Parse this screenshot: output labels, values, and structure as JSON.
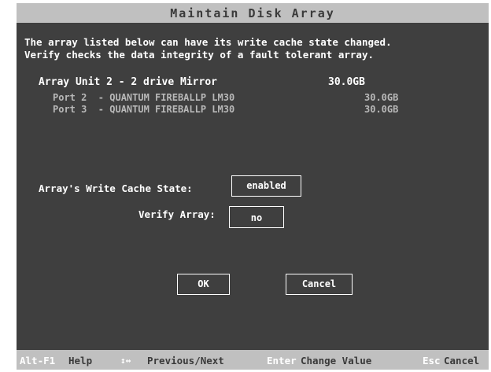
{
  "window": {
    "title": "Maintain Disk Array"
  },
  "intro": {
    "line1": "The array listed below can have its write cache state changed.",
    "line2": "Verify checks the data integrity of a fault tolerant array."
  },
  "array": {
    "unit_label": "Array Unit 2 - 2 drive Mirror",
    "unit_size": "30.0GB",
    "ports": [
      {
        "label": "Port 2  - QUANTUM FIREBALLP LM30",
        "size": "30.0GB"
      },
      {
        "label": "Port 3  - QUANTUM FIREBALLP LM30",
        "size": "30.0GB"
      }
    ]
  },
  "form": {
    "write_cache_label": "Array's Write Cache State:",
    "write_cache_value": "enabled",
    "verify_label": "Verify Array:",
    "verify_value": "no"
  },
  "buttons": {
    "ok": "OK",
    "cancel": "Cancel"
  },
  "statusbar": {
    "help_key": "Alt-F1",
    "help_label": "Help",
    "nav_icon": "↕↔",
    "nav_label": "Previous/Next",
    "enter_key": "Enter",
    "enter_label": "Change Value",
    "esc_key": "Esc",
    "esc_label": "Cancel"
  },
  "colors": {
    "screen_bg": "#3f3f3f",
    "bar_bg": "#c0c0c0",
    "text": "#ffffff",
    "muted_text": "#b8b8b8"
  }
}
